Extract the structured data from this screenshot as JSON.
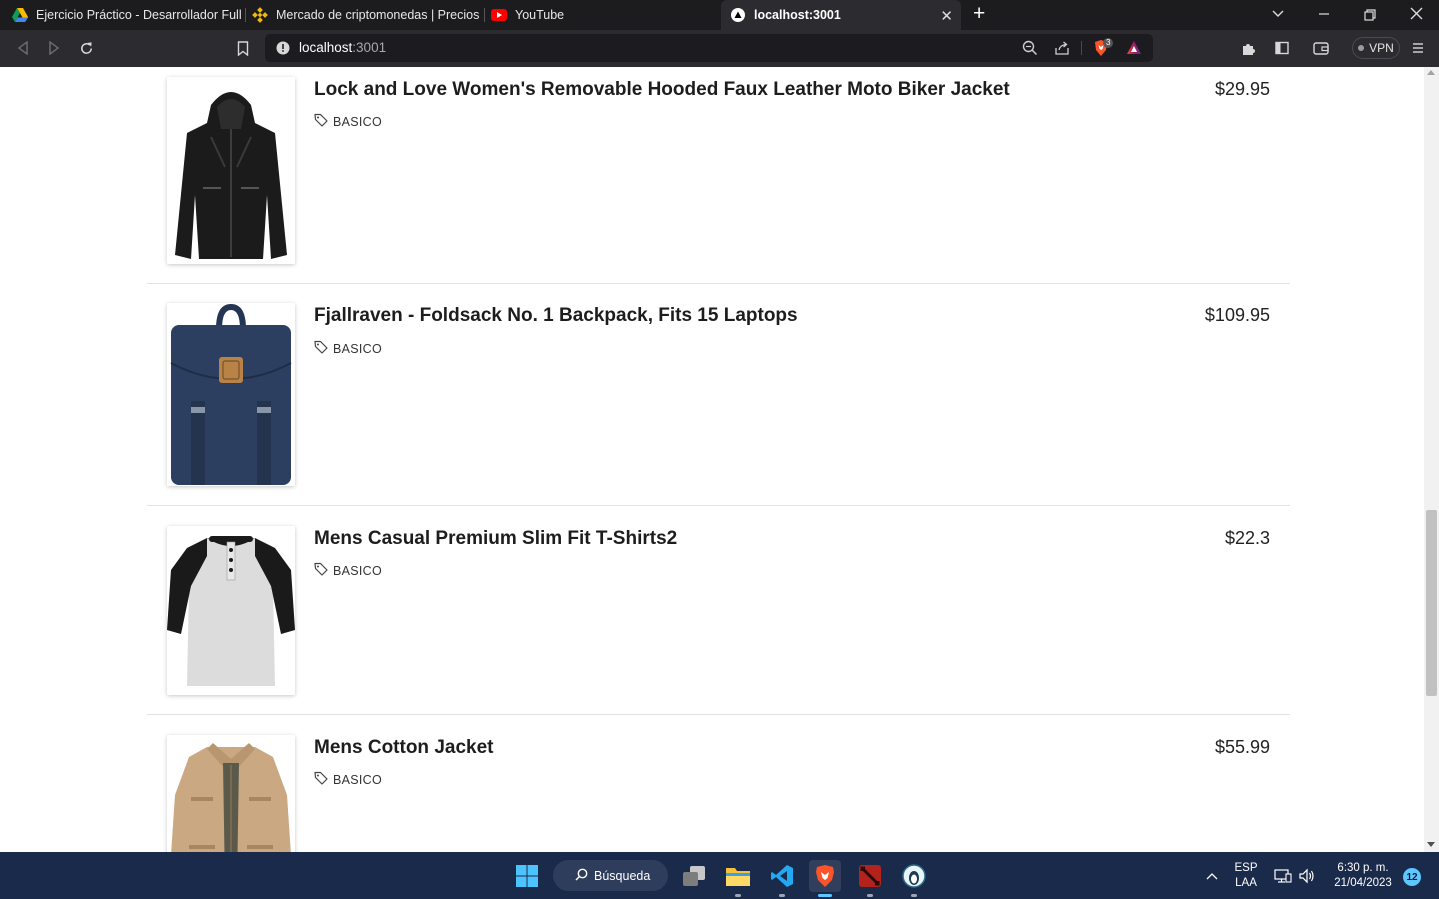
{
  "browser": {
    "tabs": [
      {
        "title": "Ejercicio Práctico - Desarrollador Full-s",
        "icon": "google-drive-icon"
      },
      {
        "title": "Mercado de criptomonedas | Precios y",
        "icon": "binance-icon"
      },
      {
        "title": "YouTube",
        "icon": "youtube-icon"
      },
      {
        "title": "localhost:3001",
        "icon": "vercel-icon",
        "active": true
      }
    ],
    "address": {
      "host": "localhost",
      "port": ":3001"
    },
    "shields_count": "3",
    "vpn_label": "VPN"
  },
  "products": [
    {
      "name": "Lock and Love Women's Removable Hooded Faux Leather Moto Biker Jacket",
      "price": "$29.95",
      "tag": "BASICO",
      "image": "leather-jacket-image"
    },
    {
      "name": "Fjallraven - Foldsack No. 1 Backpack, Fits 15 Laptops",
      "price": "$109.95",
      "tag": "BASICO",
      "image": "backpack-image"
    },
    {
      "name": "Mens Casual Premium Slim Fit T-Shirts2",
      "price": "$22.3",
      "tag": "BASICO",
      "image": "raglan-tshirt-image"
    },
    {
      "name": "Mens Cotton Jacket",
      "price": "$55.99",
      "tag": "BASICO",
      "image": "cotton-jacket-image"
    }
  ],
  "taskbar": {
    "search_label": "Búsqueda",
    "language": {
      "line1": "ESP",
      "line2": "LAA"
    },
    "time": "6:30 p. m.",
    "date": "21/04/2023",
    "notification_count": "12"
  }
}
